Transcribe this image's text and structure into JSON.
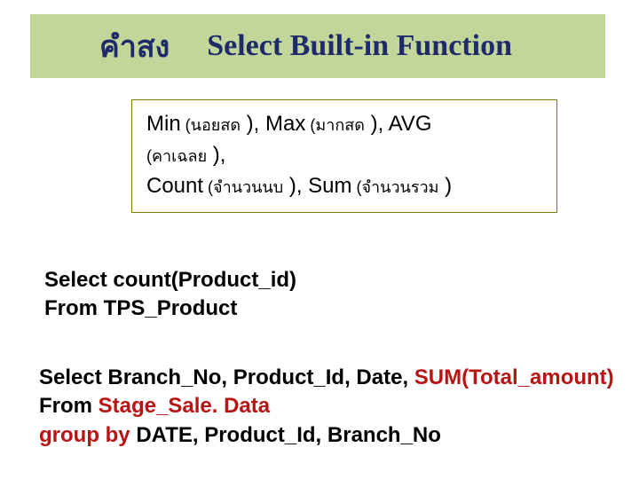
{
  "title": {
    "left": "คำสง",
    "right": "Select Built-in Function"
  },
  "funcs": {
    "l1_a": "Min",
    "l1_b": " (นอยสด",
    "l1_c": "   ), Max",
    "l1_d": " (มากสด",
    "l1_e": "  ), AVG",
    "l2_a": "(คาเฉลย",
    "l2_b": "     ),",
    "l3_a": "Count",
    "l3_b": " (จำนวนนบ",
    "l3_c": "    ), Sum",
    "l3_d": " (จำนวนรวม",
    "l3_e": "  )"
  },
  "sql1": {
    "line1": "Select count(Product_id)",
    "line2": "From TPS_Product"
  },
  "sql2": {
    "l1_a": "Select Branch_No, Product_Id, Date, ",
    "l1_b": "SUM(Total_amount)",
    "l2_a": "From ",
    "l2_b": "Stage_Sale. Data",
    "l3_a": "group by",
    "l3_b": " DATE, Product_Id, Branch_No"
  }
}
